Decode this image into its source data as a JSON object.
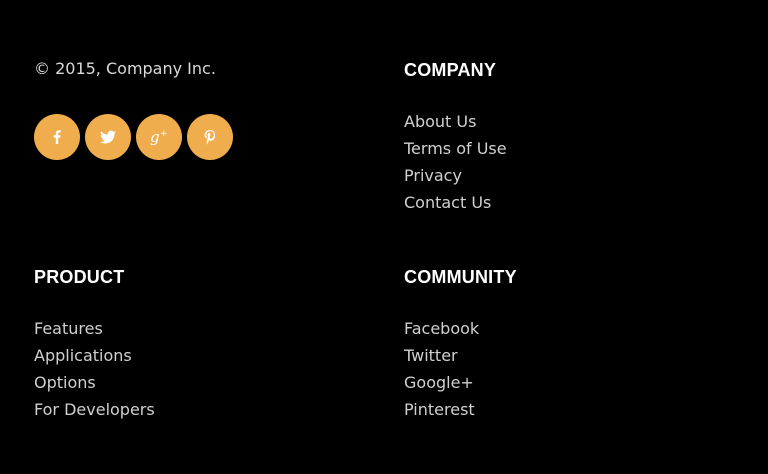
{
  "copyright": "© 2015, Company Inc.",
  "colors": {
    "background": "#000000",
    "accent": "#f0ad4e",
    "heading": "#ffffff",
    "link": "#d0d0d0"
  },
  "social": [
    {
      "name": "facebook",
      "icon": "facebook-icon"
    },
    {
      "name": "twitter",
      "icon": "twitter-icon"
    },
    {
      "name": "google-plus",
      "icon": "google-plus-icon"
    },
    {
      "name": "pinterest",
      "icon": "pinterest-icon"
    }
  ],
  "company": {
    "heading": "COMPANY",
    "links": [
      "About Us",
      "Terms of Use",
      "Privacy",
      "Contact Us"
    ]
  },
  "product": {
    "heading": "PRODUCT",
    "links": [
      "Features",
      "Applications",
      "Options",
      "For Developers"
    ]
  },
  "community": {
    "heading": "COMMUNITY",
    "links": [
      "Facebook",
      "Twitter",
      "Google+",
      "Pinterest"
    ]
  }
}
